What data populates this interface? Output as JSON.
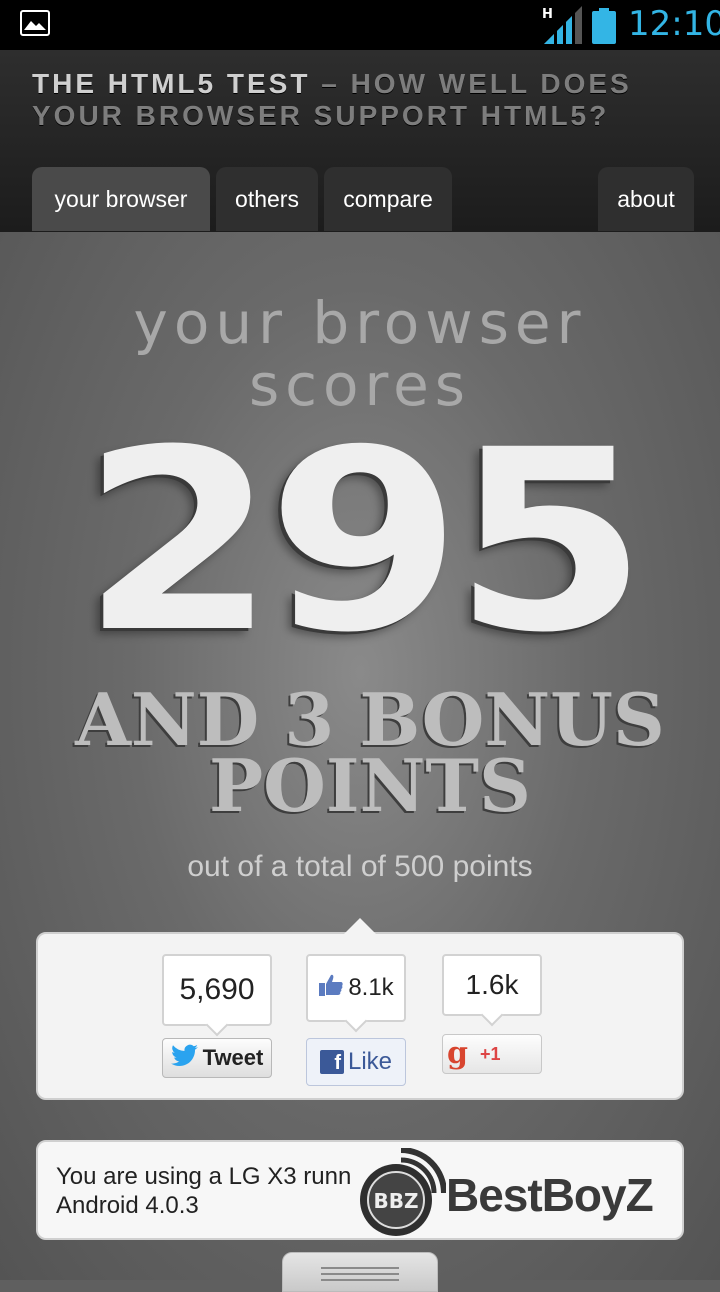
{
  "status_bar": {
    "time": "12:10",
    "network_label": "H",
    "icons": [
      "image-notification-icon",
      "signal-icon",
      "battery-icon"
    ],
    "accent_color": "#33b5e5"
  },
  "header": {
    "title_part1": "THE HTML5 TEST",
    "title_part2": " – HOW WELL DOES YOUR BROWSER SUPPORT HTML5?"
  },
  "tabs": [
    {
      "label": "your browser",
      "active": true
    },
    {
      "label": "others",
      "active": false
    },
    {
      "label": "compare",
      "active": false
    },
    {
      "label": "about",
      "active": false
    }
  ],
  "score": {
    "heading_line1": "your browser",
    "heading_line2": "scores",
    "value": "295",
    "bonus_line1": "AND 3 BONUS",
    "bonus_line2": "POINTS",
    "total_text": "out of a total of 500 points"
  },
  "social": {
    "tweet_count": "5,690",
    "tweet_label": "Tweet",
    "like_count": "8.1k",
    "like_label": "Like",
    "plusone_count": "1.6k",
    "plusone_label": "+1",
    "plusone_glyph": "g",
    "facebook_glyph": "f"
  },
  "device": {
    "text": "You are using a LG X3 runn\nAndroid 4.0.3"
  },
  "watermark": {
    "text": "BestBoyZ",
    "badge_text": "BBZ"
  }
}
